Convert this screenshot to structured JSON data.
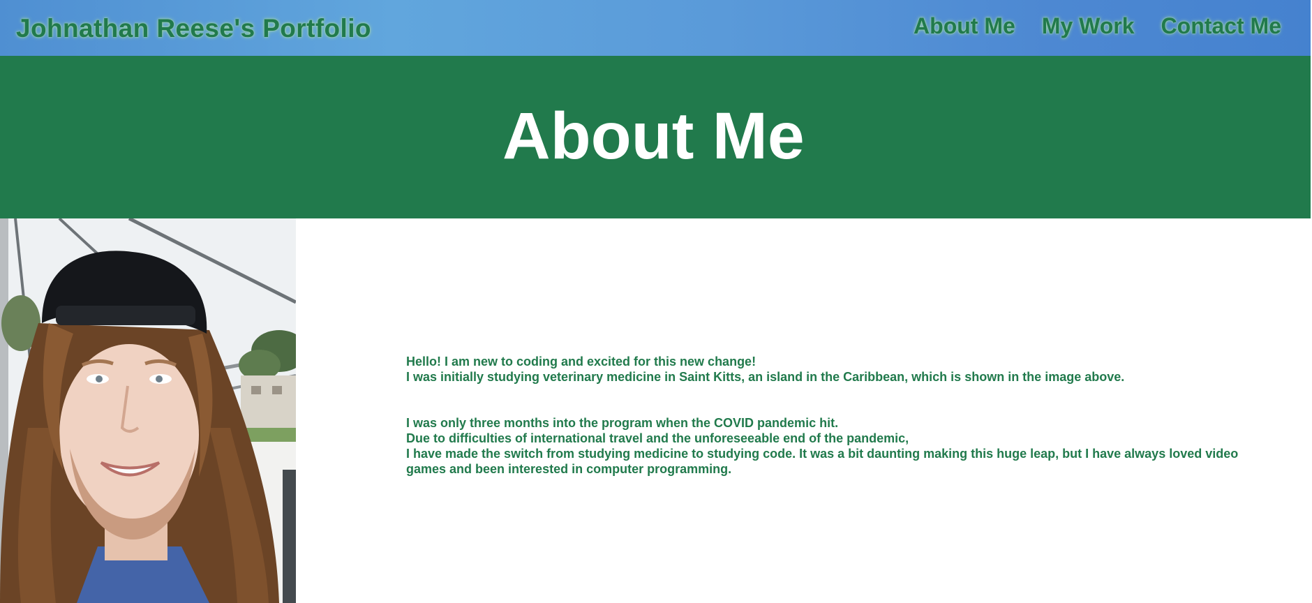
{
  "header": {
    "title": "Johnathan Reese's Portfolio",
    "nav": [
      {
        "label": "About Me"
      },
      {
        "label": "My Work"
      },
      {
        "label": "Contact Me"
      }
    ]
  },
  "hero": {
    "title": "About Me"
  },
  "portrait": {
    "alt": "photo of Johnathan Reese"
  },
  "about": {
    "paragraphs": [
      {
        "lines": [
          "Hello! I am new to coding and excited for this new change!",
          "I was initially studying veterinary medicine in Saint Kitts, an island in the Caribbean, which is shown in the image above."
        ]
      },
      {
        "lines": [
          "I was only three months into the program when the COVID pandemic hit.",
          "Due to difficulties of international travel and the unforeseeable end of the pandemic,",
          "I have made the switch from studying medicine to studying code. It was a bit daunting making this huge leap, but I have always loved video games and been interested in computer programming."
        ]
      }
    ]
  },
  "colors": {
    "brand_green": "#217a4c",
    "header_blue": "#5a9ad9",
    "hero_text": "#ffffff"
  }
}
